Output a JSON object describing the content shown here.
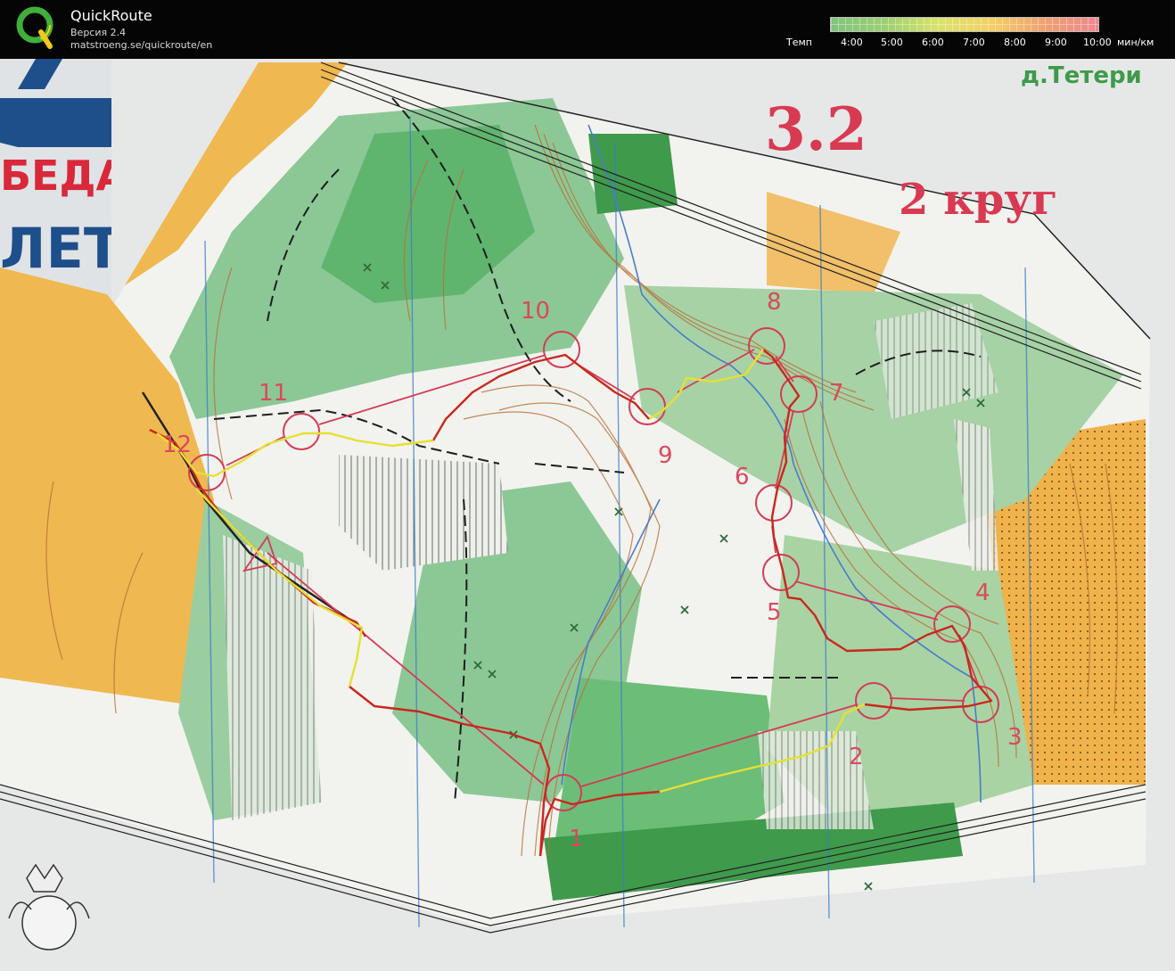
{
  "header": {
    "app_title": "QuickRoute",
    "version": "Версия 2.4",
    "url": "matstroeng.se/quickroute/en",
    "pace_label": "Темп",
    "pace_ticks": [
      "4:00",
      "5:00",
      "6:00",
      "7:00",
      "8:00",
      "9:00",
      "10:00"
    ],
    "pace_unit": "мин/км"
  },
  "map": {
    "village_label": "д.Тетери",
    "course_label": "3.2",
    "lap_label": "2 круг",
    "banner_text_1": "БЕДА!",
    "banner_text_2": "ЛЕТ",
    "controls": [
      {
        "num": "1"
      },
      {
        "num": "2"
      },
      {
        "num": "3"
      },
      {
        "num": "4"
      },
      {
        "num": "5"
      },
      {
        "num": "6"
      },
      {
        "num": "7"
      },
      {
        "num": "8"
      },
      {
        "num": "9"
      },
      {
        "num": "10"
      },
      {
        "num": "11"
      },
      {
        "num": "12"
      }
    ]
  },
  "colors": {
    "course": "#d23c56",
    "route_red": "#c8281e",
    "route_yellow": "#e6e032",
    "forest": "#8cc896",
    "open": "#f0b850"
  }
}
